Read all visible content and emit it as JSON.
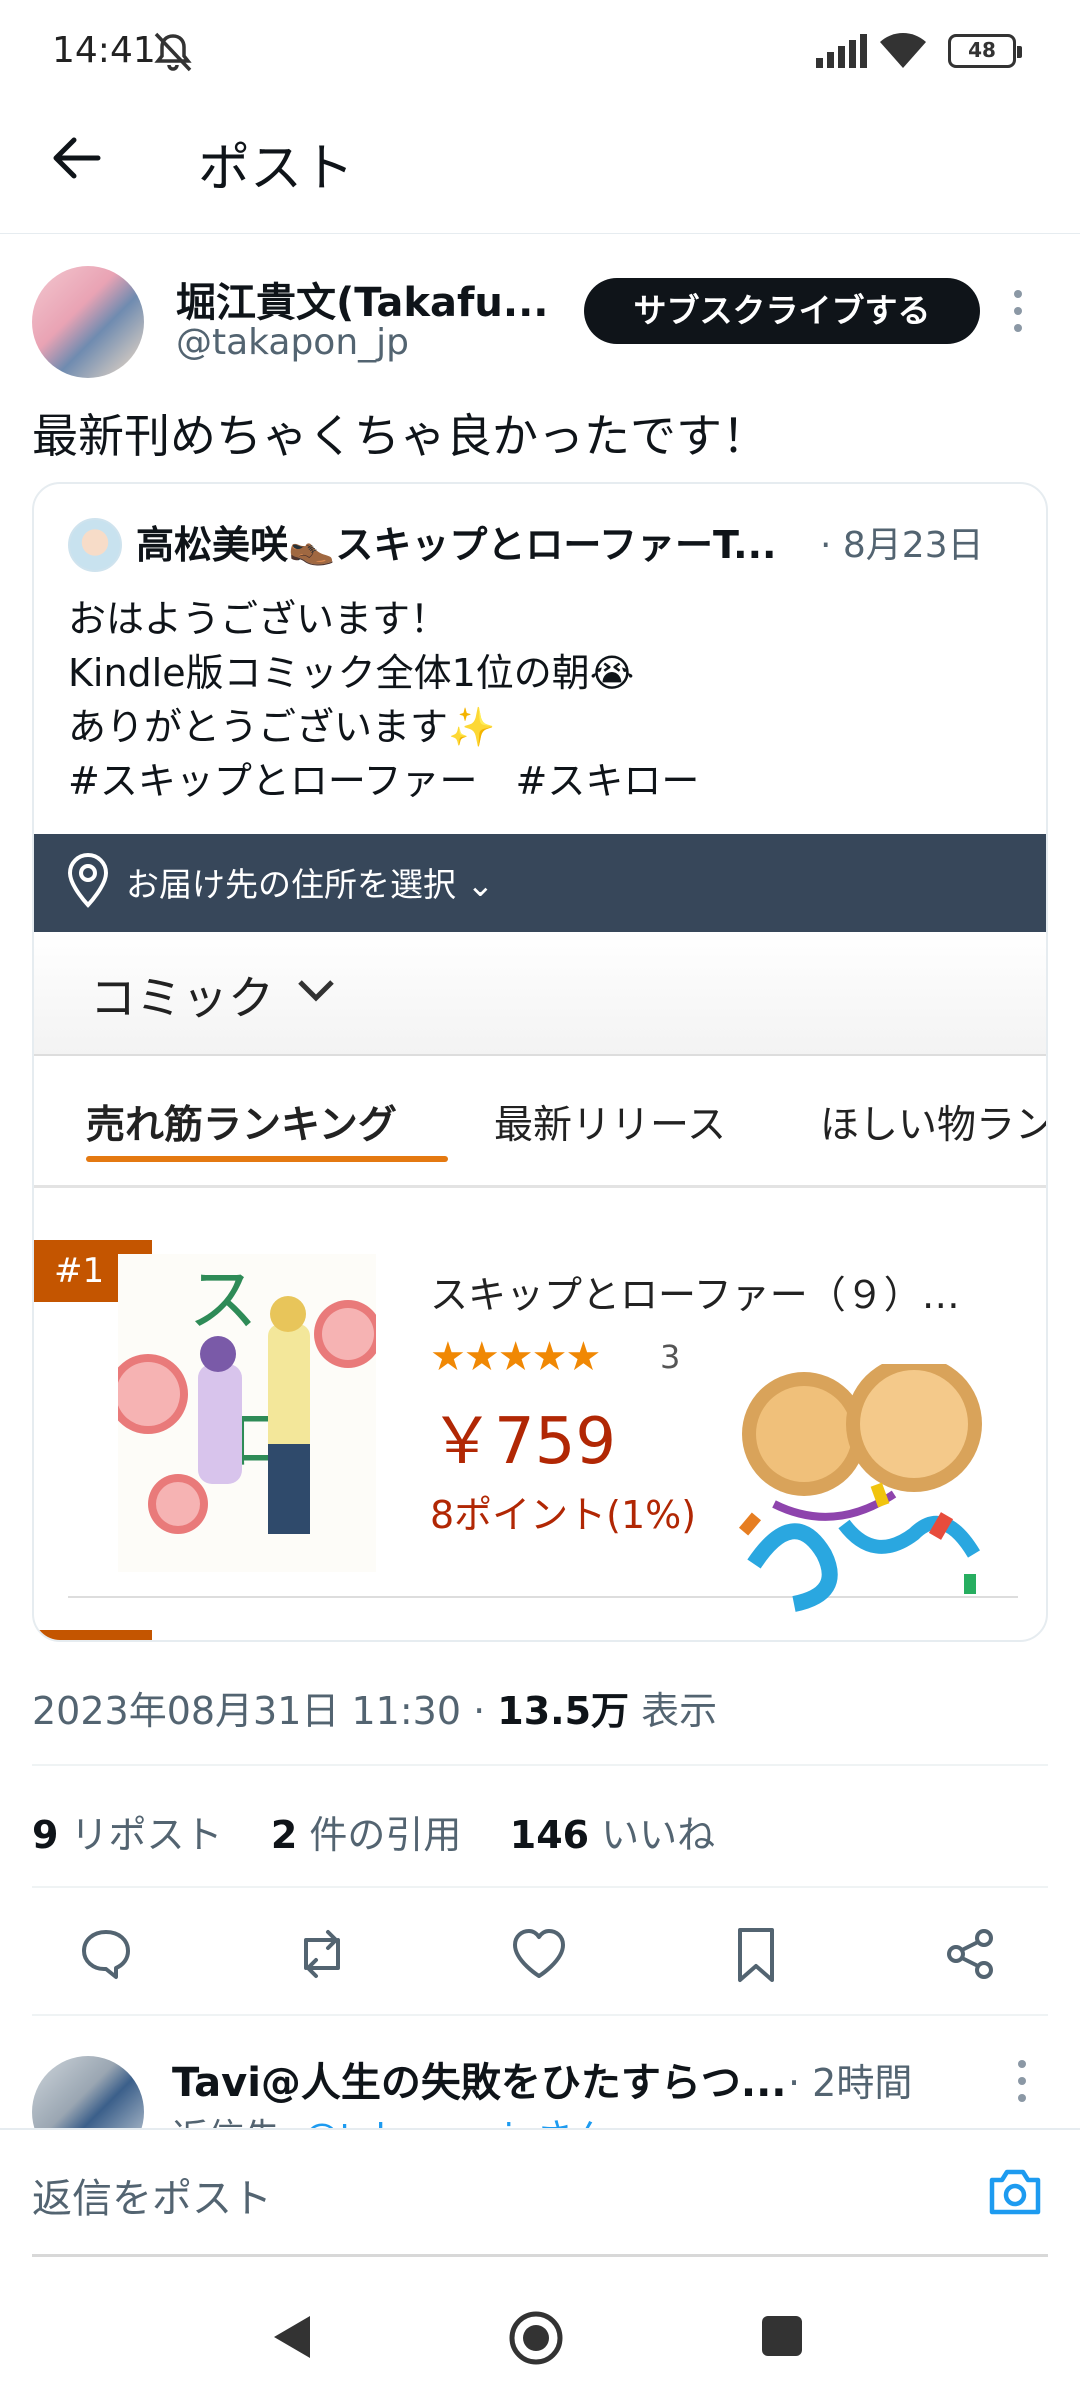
{
  "status_bar": {
    "time": "14:41",
    "battery": "48"
  },
  "header": {
    "title": "ポスト"
  },
  "post": {
    "author_name": "堀江貴文(Takafu...",
    "author_handle": "@takapon_jp",
    "subscribe_label": "サブスクライブする",
    "text": "最新刊めちゃくちゃ良かったです！"
  },
  "quote": {
    "author_name": "高松美咲👞スキップとローファーT...",
    "date": "· 8月23日",
    "lines": [
      "おはようございます！",
      "Kindle版コミック全体1位の朝😭",
      "ありがとうございます✨",
      "#スキップとローファー　#スキロー"
    ]
  },
  "amazon": {
    "deliver_label": "お届け先の住所を選択 ⌄",
    "category": "コミック",
    "tabs": [
      "売れ筋ランキング",
      "最新リリース",
      "ほしい物ラン"
    ],
    "rank_badge": "#1",
    "product_title": "スキップとローファー（９）…",
    "stars": "★★★★★",
    "review_count": "3",
    "price": "￥759",
    "points": "8ポイント(1%)",
    "rating": 5
  },
  "meta": {
    "timestamp": "2023年08月31日 11:30 · ",
    "views": "13.5万",
    "views_label": " 表示"
  },
  "stats": {
    "reposts": "9",
    "reposts_label": " リポスト",
    "quotes": "2",
    "quotes_label": " 件の引用",
    "likes": "146",
    "likes_label": " いいね"
  },
  "reply": {
    "author_name": "Tavi@人生の失敗をひたすらつ...",
    "time": "· 2時間",
    "reply_to_prefix": "返信先: ",
    "reply_to_handle": "@takapon_jpさん"
  },
  "compose": {
    "placeholder": "返信をポスト"
  },
  "colors": {
    "accent": "#1d9bf0",
    "amazon_bar": "#37475a",
    "amazon_orange": "#e47911",
    "price_red": "#b12704"
  }
}
